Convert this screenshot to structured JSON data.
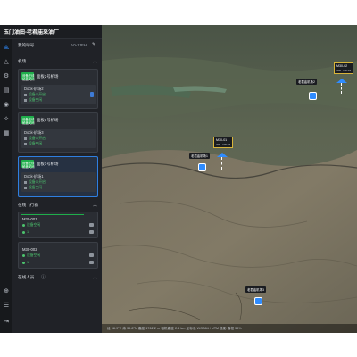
{
  "app": {
    "title": "玉门油田-老君庙采油厂"
  },
  "panel": {
    "callsign_label": "我的呼号",
    "callsign_value": "A0-1JFH",
    "docks_section": "机场",
    "docks": [
      {
        "tag_line1": "设备在线",
        "tag_line2": "舱盖关闭",
        "title": "面板2号机场",
        "dock_name": "Dock-机场2",
        "line1": "设备未开启",
        "line2": "设备空闲"
      },
      {
        "tag_line1": "设备在线",
        "tag_line2": "舱盖关闭",
        "title": "面板3号机场",
        "dock_name": "Dock-机场3",
        "line1": "设备未开启",
        "line2": "设备空闲"
      },
      {
        "tag_line1": "设备在线",
        "tag_line2": "舱盖关闭",
        "title": "面板1号机场",
        "dock_name": "Dock-机场1",
        "line1": "设备未开启",
        "line2": "设备空闲"
      }
    ],
    "drones_section": "在线飞行器",
    "drones": [
      {
        "name": "M30-001",
        "status": "设备空闲",
        "count": "1"
      },
      {
        "name": "M30-002",
        "status": "设备空闲",
        "count": "1"
      }
    ],
    "online_section": "在线人员"
  },
  "map": {
    "pins": [
      {
        "label": "老君庙机场1"
      },
      {
        "label": "老君庙机场2"
      },
      {
        "label": "老君庙机场3"
      }
    ],
    "aircraft": [
      {
        "name": "M30-01",
        "sub": "WSL-3JTHM"
      },
      {
        "name": "M30-02",
        "sub": "WSL-3JTHM"
      }
    ],
    "status_line": "经 98.9°E  纬 39.8°N  高度 1762.2 m  相机高度 2.5 km  坐标系 WGS84 / UTM 投影 高程 55%"
  },
  "colors": {
    "accent": "#2f8cff",
    "online_green": "#1fae4b",
    "panel_bg": "#202227",
    "rail_bg": "#17191c"
  },
  "icons": [
    "plane-icon",
    "warning-icon",
    "settings-icon",
    "doc-icon",
    "globe-icon",
    "compass-icon",
    "calendar-icon",
    "target-icon",
    "list-icon",
    "exit-icon",
    "edit-icon",
    "chevron-up-icon"
  ]
}
